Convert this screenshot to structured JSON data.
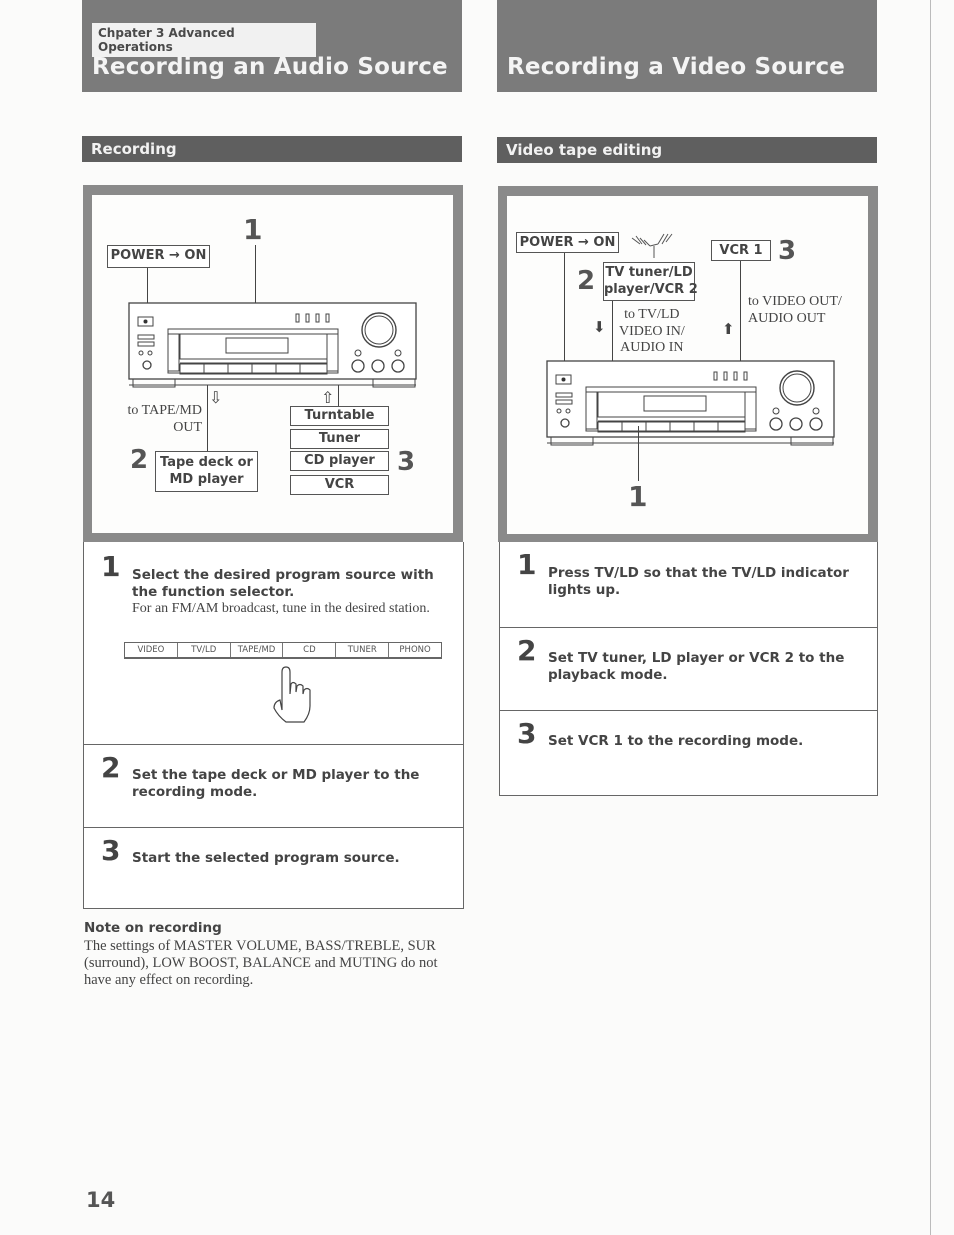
{
  "header": {
    "chapter_label": "Chpater 3 Advanced Operations",
    "left_title": "Recording an Audio Source",
    "right_title": "Recording a Video Source"
  },
  "audio": {
    "section_title": "Recording",
    "diagram": {
      "power_label": "POWER → ON",
      "step1_marker": "1",
      "step2_marker": "2",
      "step3_marker": "3",
      "tape_out_label_line1": "to TAPE/MD",
      "tape_out_label_line2": "OUT",
      "tape_deck_line1": "Tape deck or",
      "tape_deck_line2": "MD player",
      "sources": [
        "Turntable",
        "Tuner",
        "CD player",
        "VCR"
      ],
      "down_arrow": "⇩",
      "up_arrow": "⇧"
    },
    "steps": [
      {
        "num": "1",
        "text": "Select the desired program source with the function selector.",
        "sub": "For an FM/AM broadcast, tune in the desired station."
      },
      {
        "num": "2",
        "text": "Set the tape deck or MD player to the recording mode."
      },
      {
        "num": "3",
        "text": "Start the selected program source."
      }
    ],
    "function_selector": [
      "VIDEO",
      "TV/LD",
      "TAPE/MD",
      "CD",
      "TUNER",
      "PHONO"
    ],
    "note": {
      "title": "Note on recording",
      "body": "The settings of MASTER VOLUME, BASS/TREBLE, SUR (surround), LOW BOOST, BALANCE and MUTING do not have any effect on recording."
    }
  },
  "video": {
    "section_title": "Video tape editing",
    "diagram": {
      "power_label": "POWER → ON",
      "tv_box_line1": "TV tuner/LD",
      "tv_box_line2": "player/VCR 2",
      "vcr1_label": "VCR 1",
      "step1_marker": "1",
      "step2_marker": "2",
      "step3_marker": "3",
      "in_label_line1": "to TV/LD",
      "in_label_line2": "VIDEO IN/",
      "in_label_line3": "AUDIO IN",
      "out_label_line1": "to VIDEO OUT/",
      "out_label_line2": "AUDIO OUT",
      "down_arrow": "⬇",
      "up_arrow": "⬆"
    },
    "steps": [
      {
        "num": "1",
        "text": "Press TV/LD so that the TV/LD indicator lights up."
      },
      {
        "num": "2",
        "text": "Set TV tuner, LD player or VCR 2 to the playback mode."
      },
      {
        "num": "3",
        "text": "Set VCR 1 to the recording mode."
      }
    ]
  },
  "footer": {
    "page_number": "14"
  }
}
